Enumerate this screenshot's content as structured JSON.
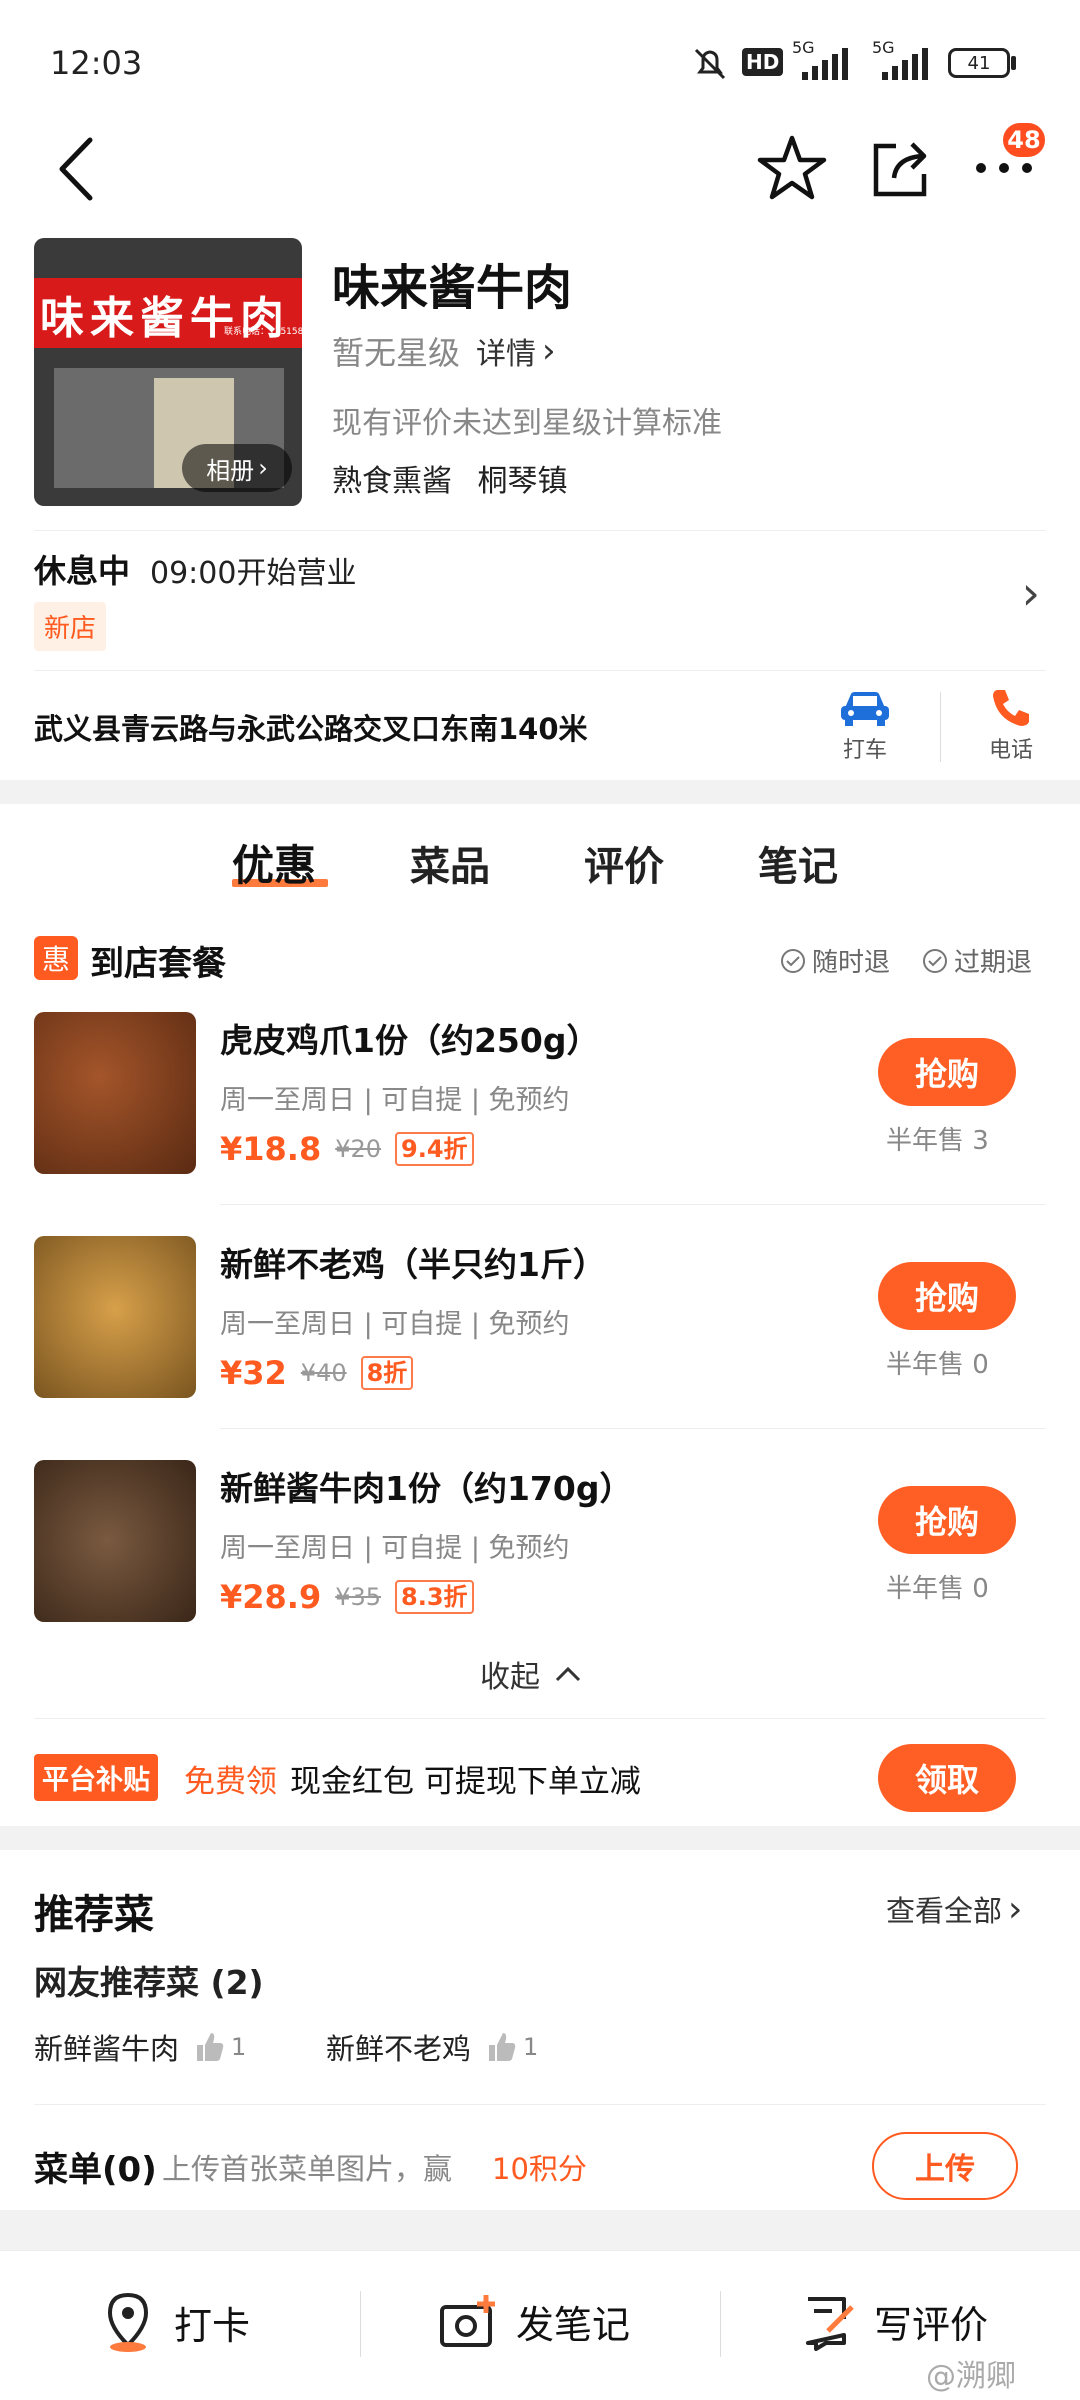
{
  "status_bar": {
    "time": "12:03",
    "battery": "41",
    "net1": "5G",
    "net2": "5G",
    "hd": "HD"
  },
  "top_nav": {
    "badge": "48"
  },
  "store": {
    "name": "味来酱牛肉",
    "rating": "暂无星级",
    "details_link": "详情",
    "rating_note": "现有评价未达到星级计算标准",
    "category": "熟食熏酱",
    "area": "桐琴镇",
    "album": "相册",
    "sign_text": "味来酱牛肉",
    "phone_sign": "联系电话：13515899"
  },
  "hours": {
    "status": "休息中",
    "open": "09:00开始营业",
    "tag": "新店"
  },
  "address": {
    "text": "武义县青云路与永武公路交叉口东南140米",
    "taxi": "打车",
    "phone": "电话"
  },
  "tabs": [
    "优惠",
    "菜品",
    "评价",
    "笔记"
  ],
  "deals_section": {
    "badge": "惠",
    "title": "到店套餐",
    "refund1": "随时退",
    "refund2": "过期退"
  },
  "deals": [
    {
      "title": "虎皮鸡爪1份（约250g）",
      "sub": "周一至周日 | 可自提 | 免预约",
      "price": "¥18.8",
      "orig": "¥20",
      "discount": "9.4折",
      "buy": "抢购",
      "sold": "半年售 3"
    },
    {
      "title": "新鲜不老鸡（半只约1斤）",
      "sub": "周一至周日 | 可自提 | 免预约",
      "price": "¥32",
      "orig": "¥40",
      "discount": "8折",
      "buy": "抢购",
      "sold": "半年售 0"
    },
    {
      "title": "新鲜酱牛肉1份（约170g）",
      "sub": "周一至周日 | 可自提 | 免预约",
      "price": "¥28.9",
      "orig": "¥35",
      "discount": "8.3折",
      "buy": "抢购",
      "sold": "半年售 0"
    }
  ],
  "collapse": "收起",
  "subsidy": {
    "tag": "平台补贴",
    "free": "免费领",
    "text": "现金红包 可提现下单立减",
    "button": "领取"
  },
  "recommend": {
    "title": "推荐菜",
    "view_all": "查看全部",
    "sub": "网友推荐菜 (2)",
    "items": [
      {
        "name": "新鲜酱牛肉",
        "likes": "1"
      },
      {
        "name": "新鲜不老鸡",
        "likes": "1"
      }
    ]
  },
  "menu": {
    "title": "菜单(0)",
    "desc": "上传首张菜单图片，赢",
    "points": "10积分",
    "button": "上传"
  },
  "bottom_bar": {
    "checkin": "打卡",
    "note": "发笔记",
    "review": "写评价"
  },
  "watermark": "@溯卿",
  "colors": {
    "accent": "#ff5f24",
    "text": "#111111",
    "muted": "#888888",
    "bg": "#f2f2f2"
  }
}
